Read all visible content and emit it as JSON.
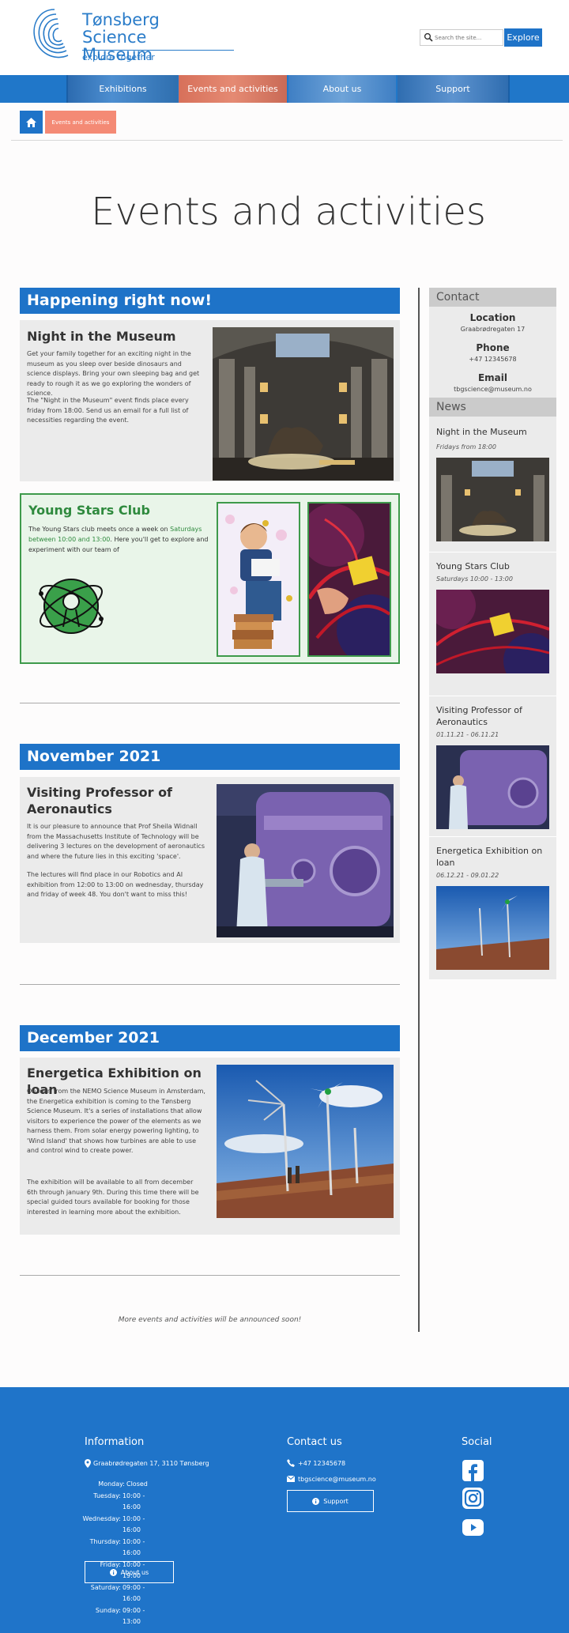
{
  "header": {
    "logo_name_line1": "Tønsberg",
    "logo_name_line2": "Science Museum",
    "logo_tagline": "explore together",
    "search_placeholder": "Search the site...",
    "search_button": "Explore"
  },
  "nav": [
    "Exhibitions",
    "Events and activities",
    "About us",
    "Support"
  ],
  "breadcrumb": {
    "current": "Events and activities"
  },
  "page_title": "Events and activities",
  "sections": {
    "now_heading": "Happening right now!",
    "night": {
      "title": "Night in the Museum",
      "p1": "Get your family together for an exciting night in the museum as you sleep over beside dinosaurs and science displays. Bring your own sleeping bag and get ready to rough it as we go exploring the wonders of science.",
      "p2": "The \"Night in the Museum\" event finds place every friday from 18:00. Send us an email for a full list of necessities regarding the event."
    },
    "young": {
      "title": "Young Stars Club",
      "p_start": "The Young Stars club meets once a week on ",
      "p_highlight": "Saturdays between 10:00 and 13:00",
      "p_end": ". Here you'll get to explore and experiment with our team of"
    },
    "nov_heading": "November 2021",
    "visiting": {
      "title": "Visiting Professor of Aeronautics",
      "p1": "It is our pleasure to announce that Prof Sheila Widnall from the Massachusetts Institute of Technology will be delivering 3 lectures on the development of aeronautics and where the future lies in this exciting 'space'.",
      "p2": "The lectures will find place in our Robotics and AI exhibition from 12:00 to 13:00 on wednesday, thursday and friday of week 48. You don't want to miss this!"
    },
    "dec_heading": "December 2021",
    "energetica": {
      "title": "Energetica Exhibition on loan",
      "p1": "On loan from the NEMO Science Museum in Amsterdam, the Energetica exhibition is coming to the Tønsberg Science Museum. It's a series of installations that allow visitors to experience the power of the elements as we harness them. From solar energy powering lighting, to 'Wind Island' that shows how turbines are able to use and control wind to create power.",
      "p2": "The exhibition will be available to all from december 6th through january 9th. During this time there will be special guided tours available for booking for those interested in learning more about the exhibition."
    },
    "more": "More events and activities will be announced soon!"
  },
  "sidebar": {
    "contact_heading": "Contact",
    "location_label": "Location",
    "location_value": "Graabrødregaten 17",
    "phone_label": "Phone",
    "phone_value": "+47 12345678",
    "email_label": "Email",
    "email_value": "tbgscience@museum.no",
    "news_heading": "News",
    "news": [
      {
        "title": "Night in the Museum",
        "date": "Fridays from 18:00"
      },
      {
        "title": "Young Stars Club",
        "date": "Saturdays 10:00 - 13:00"
      },
      {
        "title": "Visiting Professor of Aeronautics",
        "date": "01.11.21 - 06.11.21"
      },
      {
        "title": "Energetica Exhibition on loan",
        "date": "06.12.21 - 09.01.22"
      }
    ]
  },
  "footer": {
    "info_heading": "Information",
    "address": "Graabrødregaten 17, 3110 Tønsberg",
    "hours": [
      {
        "day": "Monday:",
        "time": "Closed"
      },
      {
        "day": "Tuesday:",
        "time": "10:00 - 16:00"
      },
      {
        "day": "Wednesday:",
        "time": "10:00 - 16:00"
      },
      {
        "day": "Thursday:",
        "time": "10:00 - 16:00"
      },
      {
        "day": "Friday:",
        "time": "10:00 - 19:00"
      },
      {
        "day": "Saturday:",
        "time": "09:00 - 16:00"
      },
      {
        "day": "Sunday:",
        "time": "09:00 - 13:00"
      }
    ],
    "about_button": "About us",
    "contact_heading": "Contact us",
    "phone": "+47 12345678",
    "email": "tbgscience@museum.no",
    "support_button": "Support",
    "social_heading": "Social",
    "social_icons": [
      "facebook-icon",
      "instagram-icon",
      "youtube-icon"
    ]
  },
  "colors": {
    "brand_blue": "#1f74c9",
    "accent_salmon": "#f48a75",
    "green": "#3e9a4b"
  }
}
